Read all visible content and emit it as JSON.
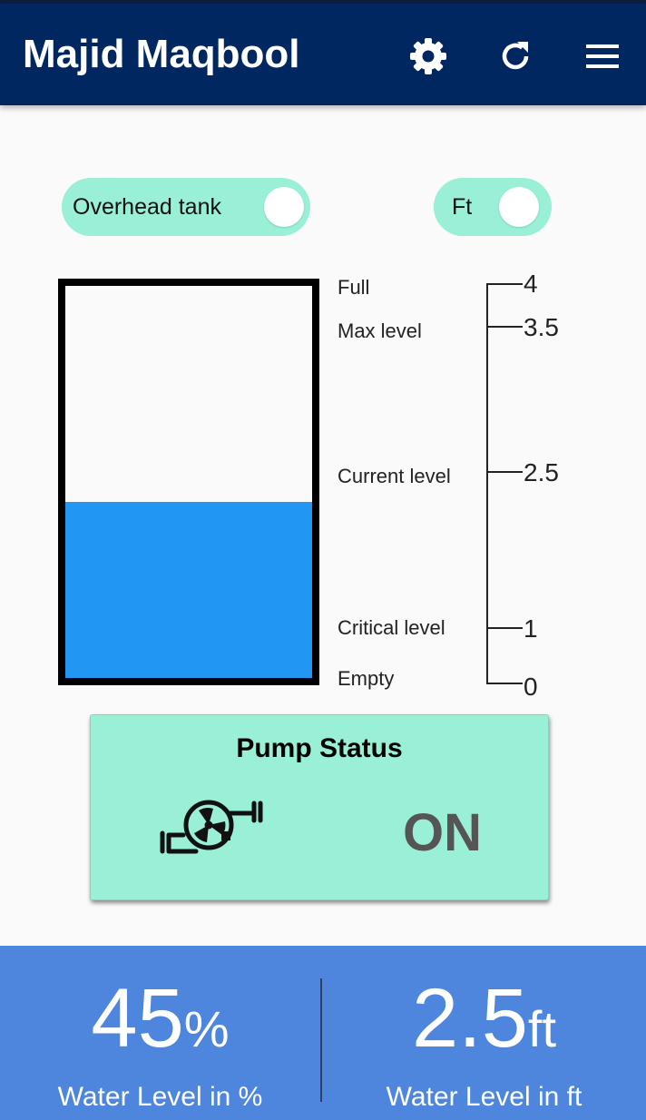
{
  "app": {
    "title": "Majid Maqbool",
    "icons": [
      "gear-icon",
      "refresh-icon",
      "menu-icon"
    ],
    "colors": {
      "app_bar": "#00275f",
      "toggle": "#9af0d6",
      "water": "#2196f3",
      "footer": "#4e86dd"
    }
  },
  "controls": {
    "tank_toggle_label": "Overhead tank",
    "unit_toggle_label": "Ft"
  },
  "tank": {
    "water_level_fraction": 0.45,
    "labels": {
      "full": "Full",
      "max": "Max level",
      "current": "Current level",
      "critical": "Critical level",
      "empty": "Empty"
    }
  },
  "scale": {
    "unit": "ft",
    "ticks": [
      "4",
      "3.5",
      "2.5",
      "1",
      "0"
    ]
  },
  "pump": {
    "title": "Pump Status",
    "state": "ON",
    "icon": "pump-icon"
  },
  "footer": {
    "percent_value": "45",
    "percent_unit": "%",
    "percent_caption": "Water Level in %",
    "ft_value": "2.5",
    "ft_unit": "ft",
    "ft_caption": "Water Level in ft"
  }
}
